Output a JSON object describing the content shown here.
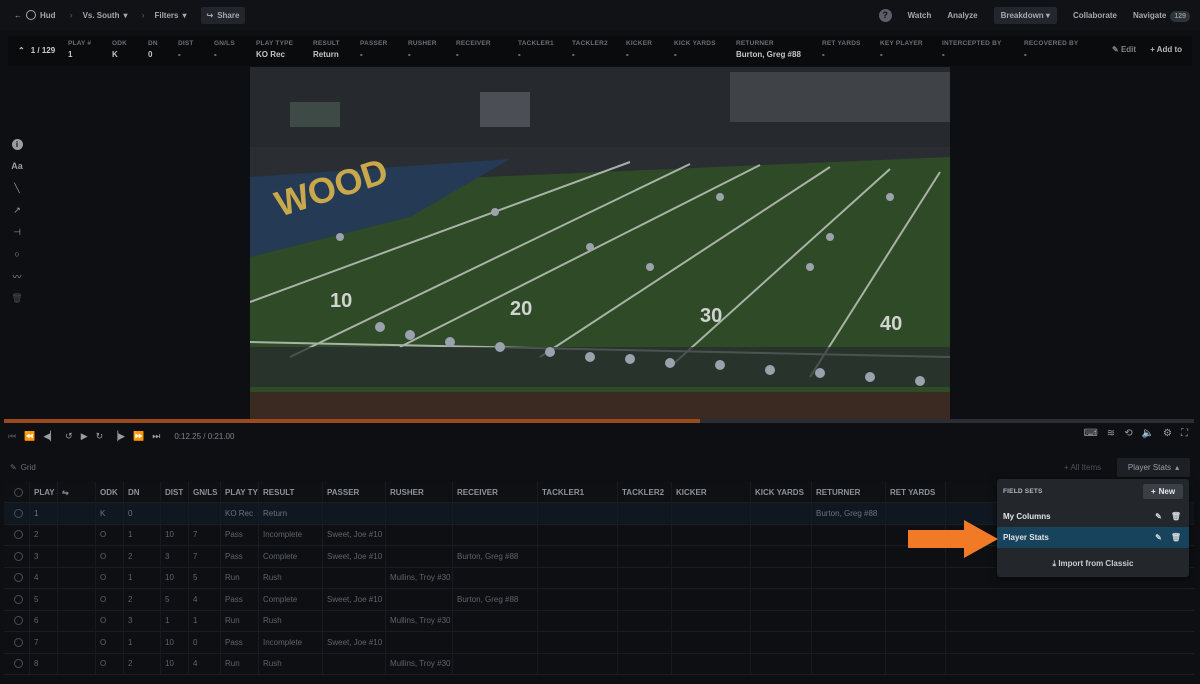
{
  "topbar": {
    "back_label": "Hud",
    "breadcrumb_1": "Vs. South",
    "filters_label": "Filters",
    "share_label": "Share",
    "nav": [
      "Watch",
      "Analyze",
      "Breakdown",
      "Collaborate",
      "Navigate"
    ],
    "navigate_count": "129",
    "help_symbol": "?"
  },
  "play_data": {
    "counter": "1 / 129",
    "columns": [
      {
        "h": "PLAY #",
        "v": "1"
      },
      {
        "h": "ODK",
        "v": "K"
      },
      {
        "h": "DN",
        "v": "0"
      },
      {
        "h": "DIST",
        "v": "-"
      },
      {
        "h": "GN/LS",
        "v": "-"
      },
      {
        "h": "PLAY TYPE",
        "v": "KO Rec"
      },
      {
        "h": "RESULT",
        "v": "Return"
      },
      {
        "h": "PASSER",
        "v": "-"
      },
      {
        "h": "RUSHER",
        "v": "-"
      },
      {
        "h": "RECEIVER",
        "v": "-"
      },
      {
        "h": "TACKLER1",
        "v": "-"
      },
      {
        "h": "TACKLER2",
        "v": "-"
      },
      {
        "h": "KICKER",
        "v": "-"
      },
      {
        "h": "KICK YARDS",
        "v": "-"
      },
      {
        "h": "RETURNER",
        "v": "Burton, Greg #88"
      },
      {
        "h": "RET YARDS",
        "v": "-"
      },
      {
        "h": "KEY PLAYER",
        "v": "-"
      },
      {
        "h": "INTERCEPTED BY",
        "v": "-"
      },
      {
        "h": "RECOVERED BY",
        "v": "-"
      }
    ],
    "edit_label": "Edit",
    "add_to_label": "Add to"
  },
  "video": {
    "field_text": "WOOD",
    "yard_numbers": [
      "10",
      "20",
      "30",
      "40"
    ]
  },
  "playback": {
    "time": "0:12.25 / 0:21.00",
    "progress": 0.585
  },
  "grid": {
    "label": "Grid",
    "all_items_label": "All Items",
    "fieldset_label": "Player Stats",
    "headers": [
      "PLAY #",
      "",
      "ODK",
      "DN",
      "DIST",
      "GN/LS",
      "PLAY TYPE",
      "RESULT",
      "PASSER",
      "RUSHER",
      "RECEIVER",
      "TACKLER1",
      "TACKLER2",
      "KICKER",
      "KICK YARDS",
      "RETURNER",
      "RET YARDS"
    ],
    "rows": [
      [
        "1",
        "",
        "K",
        "0",
        "",
        "",
        "KO Rec",
        "Return",
        "",
        "",
        "",
        "",
        "",
        "",
        "",
        "Burton, Greg #88",
        ""
      ],
      [
        "2",
        "",
        "O",
        "1",
        "10",
        "7",
        "Pass",
        "Incomplete",
        "Sweet, Joe #10",
        "",
        "",
        "",
        "",
        "",
        "",
        "",
        ""
      ],
      [
        "3",
        "",
        "O",
        "2",
        "3",
        "7",
        "Pass",
        "Complete",
        "Sweet, Joe #10",
        "",
        "Burton, Greg #88",
        "",
        "",
        "",
        "",
        "",
        ""
      ],
      [
        "4",
        "",
        "O",
        "1",
        "10",
        "5",
        "Run",
        "Rush",
        "",
        "Mullins, Troy #30",
        "",
        "",
        "",
        "",
        "",
        "",
        ""
      ],
      [
        "5",
        "",
        "O",
        "2",
        "5",
        "4",
        "Pass",
        "Complete",
        "Sweet, Joe #10",
        "",
        "Burton, Greg #88",
        "",
        "",
        "",
        "",
        "",
        ""
      ],
      [
        "6",
        "",
        "O",
        "3",
        "1",
        "1",
        "Run",
        "Rush",
        "",
        "Mullins, Troy #30",
        "",
        "",
        "",
        "",
        "",
        "",
        ""
      ],
      [
        "7",
        "",
        "O",
        "1",
        "10",
        "0",
        "Pass",
        "Incomplete",
        "Sweet, Joe #10",
        "",
        "",
        "",
        "",
        "",
        "",
        "",
        ""
      ],
      [
        "8",
        "",
        "O",
        "2",
        "10",
        "4",
        "Run",
        "Rush",
        "",
        "Mullins, Troy #30",
        "",
        "",
        "",
        "",
        "",
        "",
        ""
      ]
    ]
  },
  "field_sets": {
    "title": "FIELD SETS",
    "new_label": "New",
    "items": [
      "My Columns",
      "Player Stats"
    ],
    "active_index": 1,
    "import_label": "Import from Classic"
  },
  "colors": {
    "accent_orange": "#f07a26",
    "active_blue": "#18435c"
  }
}
